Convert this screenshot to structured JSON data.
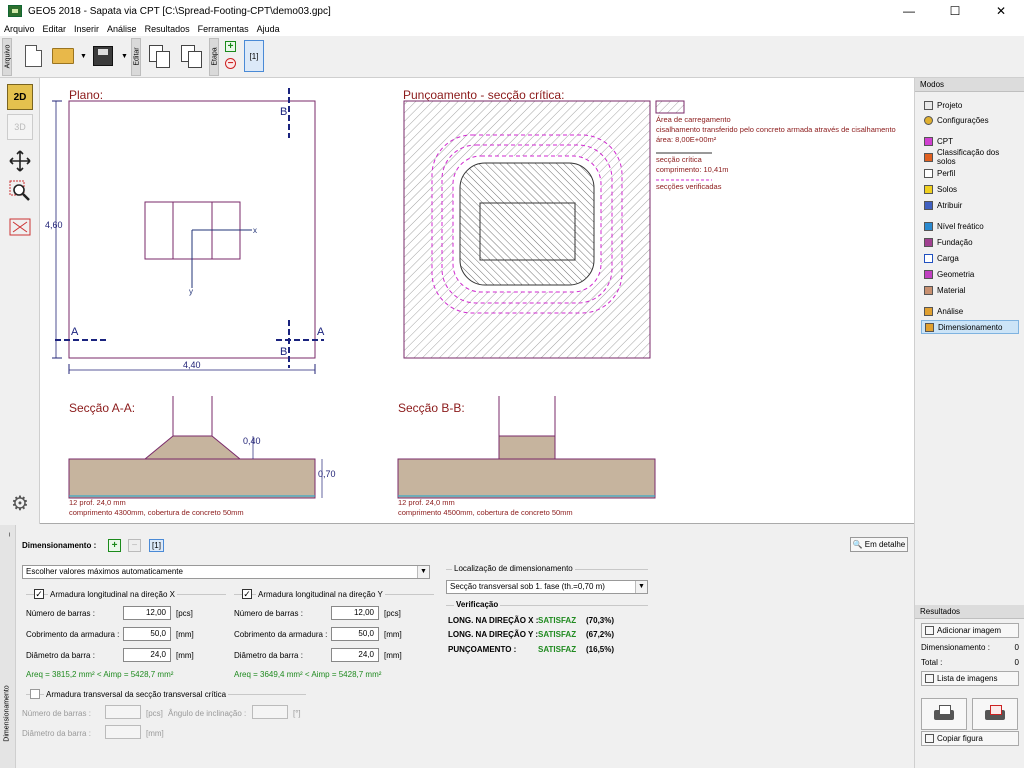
{
  "window": {
    "title": "GEO5 2018 - Sapata via CPT [C:\\Spread-Footing-CPT\\demo03.gpc]",
    "minimize": "—",
    "maximize": "☐",
    "close": "✕"
  },
  "menu": [
    "Arquivo",
    "Editar",
    "Inserir",
    "Análise",
    "Resultados",
    "Ferramentas",
    "Ajuda"
  ],
  "toolbar": {
    "tab_file": "Arquivo",
    "tab_edit": "Editar",
    "tab_stage": "Etapa",
    "stage_label": "[1]"
  },
  "left_tools": {
    "btn_2d": "2D",
    "btn_3d": "3D"
  },
  "drawing": {
    "plan_title": "Plano:",
    "plan_width": "4,40",
    "plan_length": "4,60",
    "label_a": "A",
    "label_b": "B",
    "axis_x": "x",
    "axis_y": "y",
    "punch_title": "Punçoamento - secção crítica:",
    "legend_loaded_area": "Área de carregamento",
    "legend_shear": "cisalhamento transferido pelo concreto armada através de cisalhamento",
    "legend_area": "área: 8,00E+00m²",
    "legend_critical": "secção crítica",
    "legend_length": "comprimento: 10,41m",
    "legend_verified": "secções verificadas",
    "section_aa_title": "Secção A-A:",
    "section_aa_dim1": "0,40",
    "section_aa_dim2": "0,70",
    "section_aa_note1": "12 prof. 24,0 mm",
    "section_aa_note2": "comprimento 4300mm, cobertura de concreto 50mm",
    "section_bb_title": "Secção B-B:",
    "section_bb_note1": "12 prof. 24,0 mm",
    "section_bb_note2": "comprimento 4500mm, cobertura de concreto 50mm"
  },
  "modes": {
    "header": "Modos",
    "items": [
      "Projeto",
      "Configurações",
      "CPT",
      "Classificação dos solos",
      "Perfil",
      "Solos",
      "Atribuir",
      "Nível freático",
      "Fundação",
      "Carga",
      "Geometria",
      "Material",
      "Análise",
      "Dimensionamento"
    ],
    "active": "Dimensionamento"
  },
  "results": {
    "header": "Resultados",
    "add_image": "Adicionar imagem",
    "dimensioning_label": "Dimensionamento :",
    "dimensioning_value": "0",
    "total_label": "Total :",
    "total_value": "0",
    "image_list": "Lista de imagens",
    "copy_figure": "Copiar figura"
  },
  "bottom": {
    "side_tab": "Dimensionamento",
    "header": "Dimensionamento :",
    "stage": "[1]",
    "detail_button": "Em detalhe",
    "auto_select": "Escolher valores máximos automaticamente",
    "long_x": {
      "label": "Armadura longitudinal na direção X",
      "bars_label": "Número de barras :",
      "bars_value": "12,00",
      "bars_unit": "[pcs]",
      "cover_label": "Cobrimento da armadura :",
      "cover_value": "50,0",
      "cover_unit": "[mm]",
      "diam_label": "Diâmetro da barra :",
      "diam_value": "24,0",
      "diam_unit": "[mm]",
      "check": "Areq = 3815,2 mm² < Aimp = 5428,7 mm²"
    },
    "long_y": {
      "label": "Armadura longitudinal na direção Y",
      "bars_label": "Número de barras :",
      "bars_value": "12,00",
      "bars_unit": "[pcs]",
      "cover_label": "Cobrimento da armadura :",
      "cover_value": "50,0",
      "cover_unit": "[mm]",
      "diam_label": "Diâmetro da barra :",
      "diam_value": "24,0",
      "diam_unit": "[mm]",
      "check": "Areq = 3649,4 mm² < Aimp = 5428,7 mm²"
    },
    "transverse": {
      "label": "Armadura transversal da secção transversal crítica",
      "bars_label": "Número de barras :",
      "bars_unit": "[pcs]",
      "angle_label": "Ângulo de inclinação :",
      "angle_unit": "[°]",
      "diam_label": "Diâmetro da barra :",
      "diam_unit": "[mm]"
    },
    "location_title": "Localização de dimensionamento",
    "location_value": "Secção transversal sob 1. fase (th.=0,70 m)",
    "verification_title": "Verificação",
    "verification": [
      {
        "label": "LONG. NA DIREÇÃO X :",
        "status": "SATISFAZ",
        "value": "(70,3%)"
      },
      {
        "label": "LONG. NA DIREÇÃO Y :",
        "status": "SATISFAZ",
        "value": "(67,2%)"
      },
      {
        "label": "PUNÇOAMENTO :",
        "status": "SATISFAZ",
        "value": "(16,5%)"
      }
    ]
  }
}
